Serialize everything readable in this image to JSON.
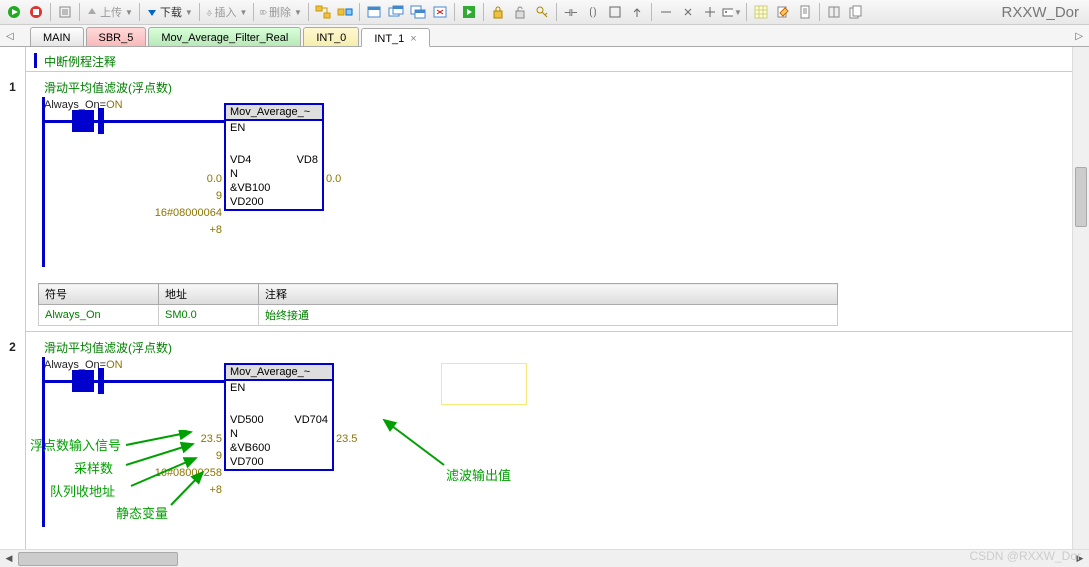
{
  "app_title": "RXXW_Dor",
  "toolbar": {
    "upload_label": "上传",
    "download_label": "下载",
    "insert_label": "插入",
    "delete_label": "删除"
  },
  "tabs": [
    {
      "label": "MAIN",
      "cls": ""
    },
    {
      "label": "SBR_5",
      "cls": "red"
    },
    {
      "label": "Mov_Average_Filter_Real",
      "cls": "green"
    },
    {
      "label": "INT_0",
      "cls": "yellow"
    },
    {
      "label": "INT_1",
      "cls": "active",
      "closable": true
    }
  ],
  "interrupt_comment": "中断例程注释",
  "networks": [
    {
      "num": "1",
      "title": "滑动平均值滤波(浮点数)",
      "contact_label": "Always_On=",
      "contact_val": "ON",
      "block": {
        "name": "Mov_Average_~",
        "en": "EN",
        "rows": [
          {
            "in_val": "0.0",
            "in_pin": "VD4",
            "out_pin": "VD8",
            "out_val": "0.0"
          },
          {
            "in_val": "9",
            "in_pin": "N"
          },
          {
            "in_val": "16#08000064",
            "in_pin": "&VB100"
          },
          {
            "in_val": "+8",
            "in_pin": "VD200"
          }
        ]
      },
      "symtable": {
        "headers": [
          "符号",
          "地址",
          "注释"
        ],
        "rows": [
          {
            "sym": "Always_On",
            "addr": "SM0.0",
            "comment": "始终接通"
          }
        ]
      }
    },
    {
      "num": "2",
      "title": "滑动平均值滤波(浮点数)",
      "contact_label": "Always_On=",
      "contact_val": "ON",
      "block": {
        "name": "Mov_Average_~",
        "en": "EN",
        "rows": [
          {
            "in_val": "23.5",
            "in_pin": "VD500",
            "out_pin": "VD704",
            "out_val": "23.5"
          },
          {
            "in_val": "9",
            "in_pin": "N"
          },
          {
            "in_val": "16#08000258",
            "in_pin": "&VB600"
          },
          {
            "in_val": "+8",
            "in_pin": "VD700"
          }
        ]
      },
      "annotations": {
        "float_input": "浮点数输入信号",
        "sample_count": "采样数",
        "queue_addr": "队列收地址",
        "static_var": "静态变量",
        "filter_out": "滤波输出值"
      }
    }
  ],
  "watermark": "CSDN @RXXW_Dor"
}
